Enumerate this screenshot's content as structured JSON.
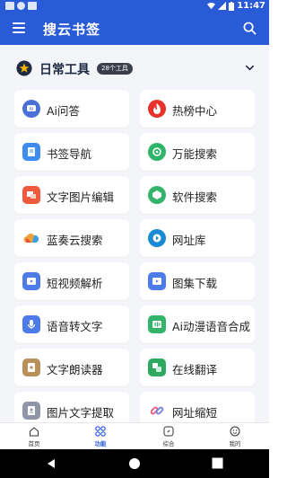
{
  "status_bar": {
    "time": "11:47"
  },
  "app_bar": {
    "title": "搜云书签"
  },
  "section": {
    "title": "日常工具",
    "badge": "28个工具"
  },
  "tools": [
    {
      "label": "Ai问答",
      "icon": "ai-chat-icon",
      "color": "#4a6fd6"
    },
    {
      "label": "热榜中心",
      "icon": "flame-icon",
      "color": "#e8332d"
    },
    {
      "label": "书签导航",
      "icon": "bookmark-icon",
      "color": "#3f8cf0"
    },
    {
      "label": "万能搜索",
      "icon": "search-chat-icon",
      "color": "#2fb56a"
    },
    {
      "label": "文字图片编辑",
      "icon": "text-image-edit-icon",
      "color": "#ef5a3c"
    },
    {
      "label": "软件搜索",
      "icon": "software-search-icon",
      "color": "#34b36b"
    },
    {
      "label": "蓝奏云搜索",
      "icon": "cloud-icon",
      "color": "#f0a23a"
    },
    {
      "label": "网址库",
      "icon": "url-library-icon",
      "color": "#1a8ad4"
    },
    {
      "label": "短视频解析",
      "icon": "short-video-icon",
      "color": "#4d7be8"
    },
    {
      "label": "图集下载",
      "icon": "album-download-icon",
      "color": "#4d7be8"
    },
    {
      "label": "语音转文字",
      "icon": "voice-to-text-icon",
      "color": "#4d7be8"
    },
    {
      "label": "Ai动漫语音合成",
      "icon": "ai-voice-icon",
      "color": "#34b36b"
    },
    {
      "label": "文字朗读器",
      "icon": "text-reader-icon",
      "color": "#b8905a"
    },
    {
      "label": "在线翻译",
      "icon": "translate-icon",
      "color": "#2fa860"
    },
    {
      "label": "图片文字提取",
      "icon": "image-text-extract-icon",
      "color": "#8e96a8"
    },
    {
      "label": "网址缩短",
      "icon": "link-shorten-icon",
      "color": "#e35b7a"
    }
  ],
  "bottom_nav": [
    {
      "label": "首页",
      "icon": "home-icon"
    },
    {
      "label": "功能",
      "icon": "grid-icon"
    },
    {
      "label": "综合",
      "icon": "compass-icon"
    },
    {
      "label": "我的",
      "icon": "profile-icon"
    }
  ],
  "colors": {
    "primary": "#2a5bd7",
    "background": "#f4f5f8"
  }
}
